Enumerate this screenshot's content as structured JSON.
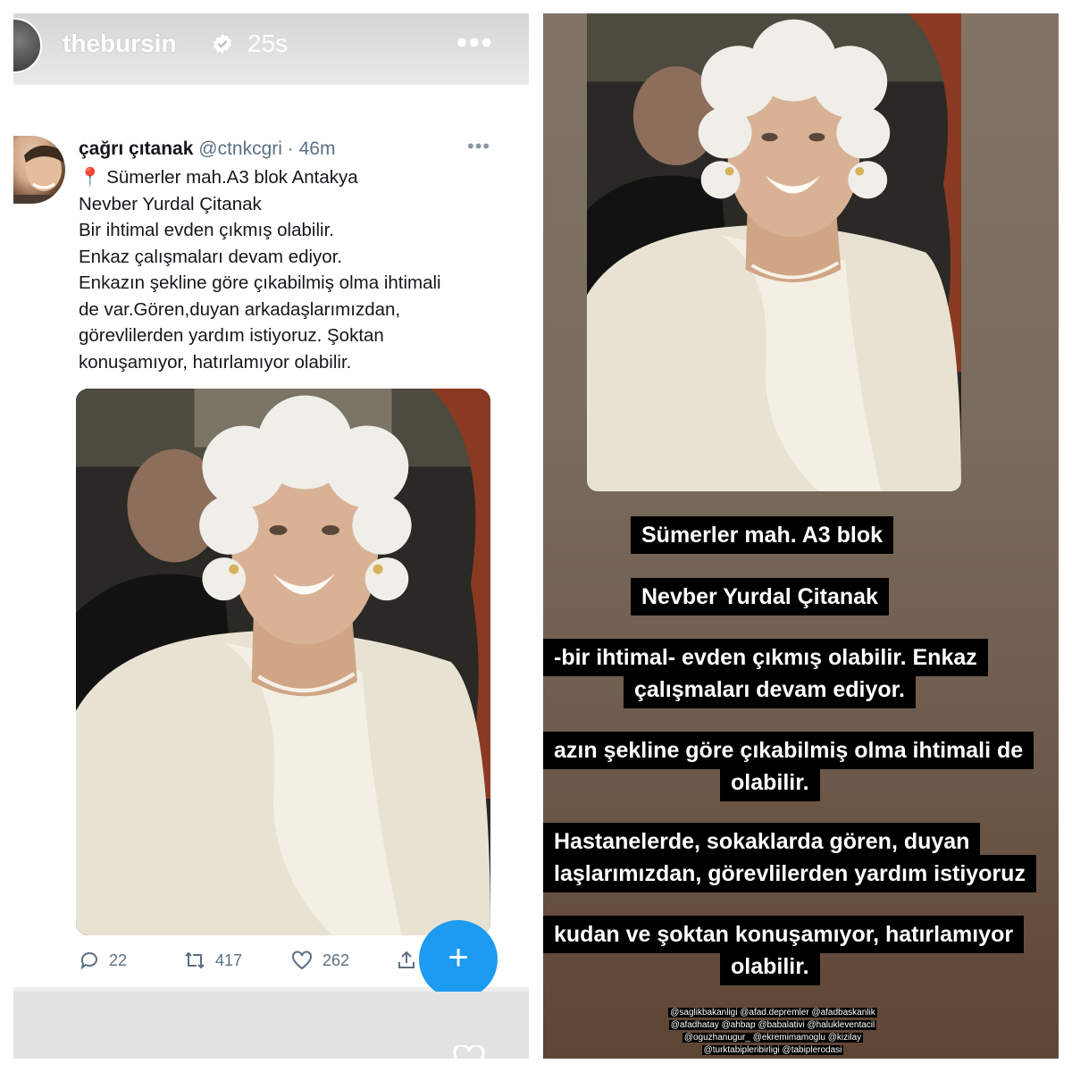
{
  "story": {
    "username": "thebursin",
    "time_ago": "25s",
    "more_label": "•••"
  },
  "tweet": {
    "display_name": "çağrı çıtanak",
    "handle_time": "@ctnkcgri · 46m",
    "more_label": "•••",
    "location_icon": "pin-icon",
    "lines": [
      "Sümerler mah.A3 blok Antakya",
      "Nevber Yurdal Çitanak",
      "Bir ihtimal evden çıkmış olabilir.",
      "Enkaz çalışmaları devam ediyor.",
      "Enkazın şekline göre çıkabilmiş olma ihtimali",
      "de var.Gören,duyan arkadaşlarımızdan,",
      "görevlilerden yardım istiyoruz. Şoktan",
      "konuşamıyor, hatırlamıyor olabilir."
    ],
    "actions": {
      "replies": "22",
      "retweets": "417",
      "likes": "262"
    },
    "fab_label": "+"
  },
  "captions": [
    "Sümerler mah. A3 blok",
    "Nevber Yurdal Çitanak",
    "-bir ihtimal- evden çıkmış olabilir. Enkaz",
    "çalışmaları devam ediyor.",
    "azın şekline göre çıkabilmiş olma ihtimali de",
    "olabilir.",
    "Hastanelerde, sokaklarda gören, duyan",
    "laşlarımızdan, görevlilerden yardım istiyoruz",
    "kudan ve şoktan konuşamıyor, hatırlamıyor",
    "olabilir."
  ],
  "mentions": [
    "@saglikbakanligi @afad.depremler @afadbaskanlik",
    "@afadhatay @ahbap @babalativi @halukleventacil",
    "@oguzhanugur_ @ekremimamoglu @kizilay",
    "@turktabipleribirligi @tabiplerodasi"
  ],
  "colors": {
    "accent": "#1d9bf0",
    "caption_bg": "#000000",
    "caption_text": "#ffffff"
  }
}
